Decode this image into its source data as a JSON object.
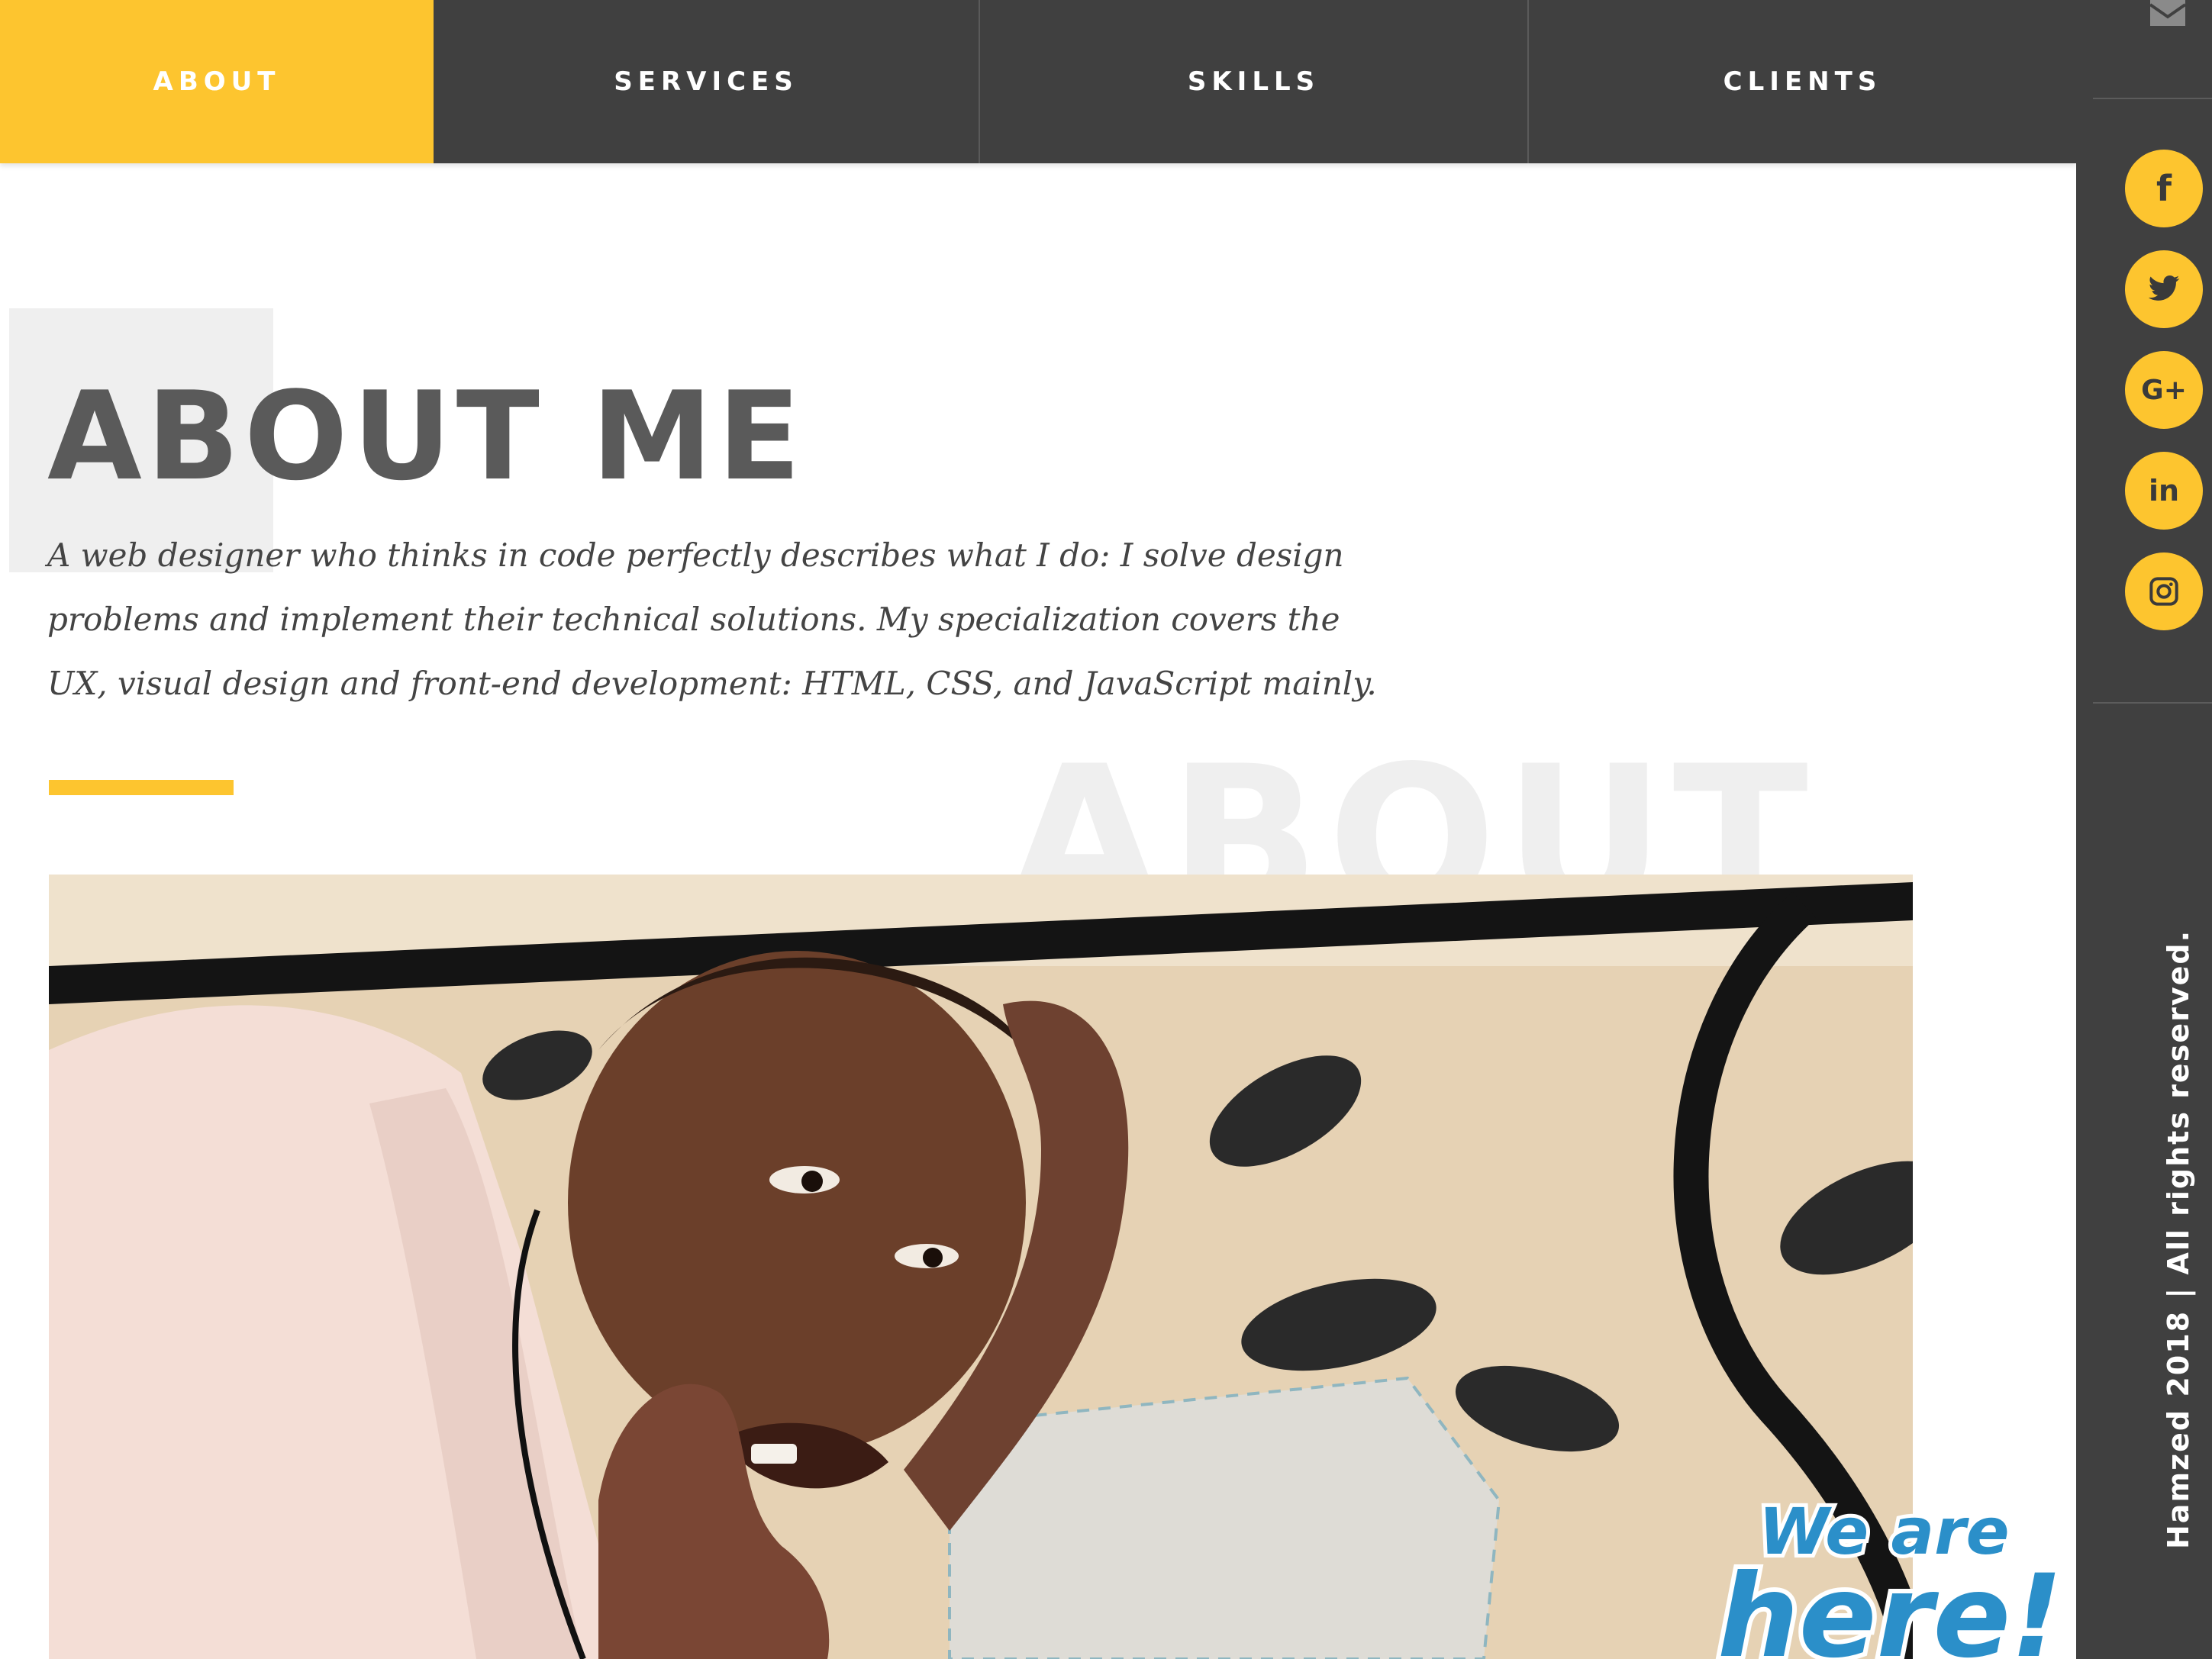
{
  "nav": {
    "tabs": [
      {
        "label": "ABOUT",
        "active": true
      },
      {
        "label": "SERVICES",
        "active": false
      },
      {
        "label": "SKILLS",
        "active": false
      },
      {
        "label": "CLIENTS",
        "active": false
      }
    ]
  },
  "sidebar": {
    "social": [
      {
        "icon": "facebook-icon",
        "glyph": "f"
      },
      {
        "icon": "twitter-icon",
        "glyph": ""
      },
      {
        "icon": "google-plus-icon",
        "glyph": "G+"
      },
      {
        "icon": "linkedin-icon",
        "glyph": "in"
      },
      {
        "icon": "instagram-icon",
        "glyph": ""
      }
    ],
    "copyright": "Hamzed 2018 | All rights reserved."
  },
  "about": {
    "title": "ABOUT ME",
    "intro": "A web designer who thinks in code perfectly describes what I do: I solve design problems and implement their technical solutions. My specialization covers the UX, visual design and front-end development: HTML, CSS, and JavaScript mainly.",
    "watermark": "ABOUT"
  },
  "chat_widget": {
    "line1": "We are",
    "line2": "here!"
  },
  "colors": {
    "accent": "#fdc52f",
    "dark": "#404040",
    "title": "#5a5a5a",
    "badge": "#2b8fc9"
  }
}
